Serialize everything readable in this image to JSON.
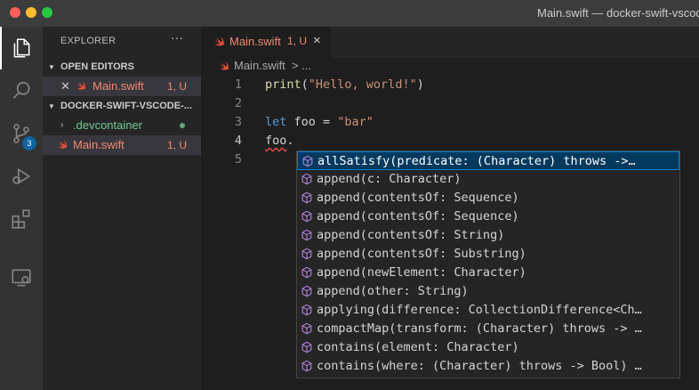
{
  "window": {
    "title": "Main.swift — docker-swift-vscode"
  },
  "activity_bar": {
    "items": [
      "files-icon",
      "search-icon",
      "source-control-icon",
      "run-debug-icon",
      "extensions-icon",
      "remote-explorer-icon"
    ],
    "source_control_badge": "3"
  },
  "sidebar": {
    "title": "EXPLORER",
    "more": "···",
    "open_editors": {
      "header": "OPEN EDITORS",
      "items": [
        {
          "name": "Main.swift",
          "meta": "1, U"
        }
      ]
    },
    "workspace": {
      "header": "DOCKER-SWIFT-VSCODE-...",
      "items": [
        {
          "name": ".devcontainer"
        },
        {
          "name": "Main.swift",
          "meta": "1, U"
        }
      ]
    }
  },
  "tabs": [
    {
      "name": "Main.swift",
      "meta": "1, U",
      "close": "×"
    }
  ],
  "breadcrumb": {
    "file": "Main.swift",
    "more": "> ..."
  },
  "editor": {
    "lines": [
      {
        "num": "1"
      },
      {
        "num": "2"
      },
      {
        "num": "3"
      },
      {
        "num": "4"
      },
      {
        "num": "5"
      }
    ],
    "code": {
      "l1_fn": "print",
      "l1_open": "(",
      "l1_str": "\"Hello, world!\"",
      "l1_close": ")",
      "l3_kw": "let",
      "l3_mid": " foo = ",
      "l3_str": "\"bar\"",
      "l4_var": "foo",
      "l4_dot": "."
    }
  },
  "suggestions": [
    "allSatisfy(predicate: (Character) throws ->…",
    "append(c: Character)",
    "append(contentsOf: Sequence)",
    "append(contentsOf: Sequence)",
    "append(contentsOf: String)",
    "append(contentsOf: Substring)",
    "append(newElement: Character)",
    "append(other: String)",
    "applying(difference: CollectionDifference<Ch…",
    "compactMap(transform: (Character) throws -> …",
    "contains(element: Character)",
    "contains(where: (Character) throws -> Bool) …"
  ],
  "colors": {
    "swift_orange": "#f05138",
    "error_text": "#f48771",
    "cube_purple": "#b180d7",
    "selection": "#04395e",
    "badge_blue": "#0e639c"
  }
}
